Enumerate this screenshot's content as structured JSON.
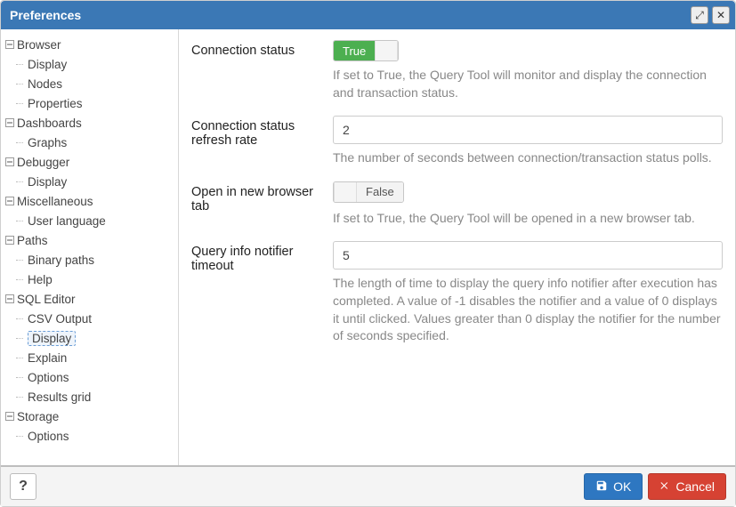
{
  "title": "Preferences",
  "titlebar": {
    "maximize_icon_text": "⤢",
    "close_icon_text": "✕"
  },
  "sidebar": {
    "groups": [
      {
        "label": "Browser",
        "children": [
          "Display",
          "Nodes",
          "Properties"
        ]
      },
      {
        "label": "Dashboards",
        "children": [
          "Graphs"
        ]
      },
      {
        "label": "Debugger",
        "children": [
          "Display"
        ]
      },
      {
        "label": "Miscellaneous",
        "children": [
          "User language"
        ]
      },
      {
        "label": "Paths",
        "children": [
          "Binary paths",
          "Help"
        ]
      },
      {
        "label": "SQL Editor",
        "children": [
          "CSV Output",
          "Display",
          "Explain",
          "Options",
          "Results grid"
        ]
      },
      {
        "label": "Storage",
        "children": [
          "Options"
        ]
      }
    ],
    "selected_group": "SQL Editor",
    "selected_child": "Display"
  },
  "form": {
    "conn_status": {
      "label": "Connection status",
      "value": "True",
      "help": "If set to True, the Query Tool will monitor and display the connection and transaction status."
    },
    "conn_refresh": {
      "label": "Connection status refresh rate",
      "value": "2",
      "help": "The number of seconds between connection/transaction status polls."
    },
    "new_tab": {
      "label": "Open in new browser tab",
      "value": "False",
      "help": "If set to True, the Query Tool will be opened in a new browser tab."
    },
    "notifier": {
      "label": "Query info notifier timeout",
      "value": "5",
      "help": "The length of time to display the query info notifier after execution has completed. A value of -1 disables the notifier and a value of 0 displays it until clicked. Values greater than 0 display the notifier for the number of seconds specified."
    }
  },
  "footer": {
    "help": "?",
    "ok": "OK",
    "cancel": "Cancel"
  }
}
